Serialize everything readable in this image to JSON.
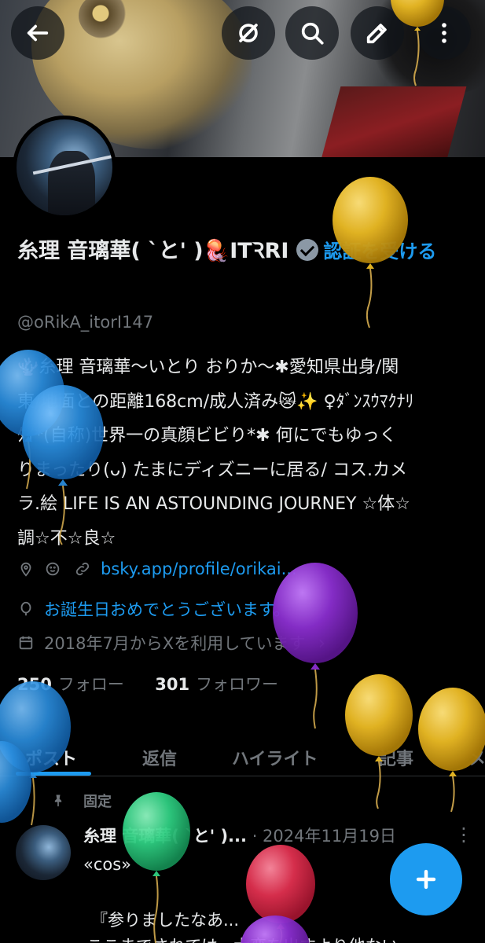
{
  "header": {
    "back_icon": "arrow-left-icon",
    "buttons": [
      "hide-media-icon",
      "search-icon",
      "edit-icon",
      "more-vertical-icon"
    ]
  },
  "profile": {
    "display_name": "糸理 音璃華( `と' )🪼ITꝚRI",
    "verify_link": "認証を受ける",
    "handle": "@oRikA_itorI147",
    "bio_lines": [
      "🪸糸理 音璃華〜いとり おりか〜✱愛知県出身/関",
      "東/地面との距離168cm/成人済み😿✨ ♀ﾀﾞﾝｽｳﾏｸﾅﾘ",
      "ﾀｲ*(自称)世界一の真顔ビビり*✱ 何にでもゆっく",
      "りまったり(ᴗ) たまにディズニーに居る/ コス.カメ",
      "ラ.絵 LIFE IS AN ASTOUNDING JOURNEY ☆体☆",
      "調☆不☆良☆"
    ],
    "location_icon": "location-pin-icon",
    "smile_icon": "smile-icon",
    "link_icon": "link-icon",
    "link_text": "bsky.app/profile/orikai...",
    "birthday_icon": "balloon-icon",
    "birthday_text": "お誕生日おめでとうございます。",
    "joined_icon": "calendar-icon",
    "joined_text": "2018年7月からXを利用しています",
    "following_count": "250",
    "following_label": "フォロー",
    "followers_count": "301",
    "followers_label": "フォロワー"
  },
  "tabs": [
    {
      "label": "ポスト"
    },
    {
      "label": "返信"
    },
    {
      "label": "ハイライト"
    },
    {
      "label": "記事"
    },
    {
      "label": "メ"
    }
  ],
  "post": {
    "pinned_label": "固定",
    "author": "糸理 音璃華( `と' )...",
    "date": "· 2024年11月19日",
    "line1": "«cos»",
    "line2": "『参りましたなあ...",
    "line3": "ここまでされては...大変を出すより他ない"
  },
  "fab_icon": "plus-icon",
  "balloon_colors": {
    "yellow": "#e8b824",
    "blue": "#2b8fe0",
    "purple": "#8b2fd0",
    "green": "#2fcf82",
    "red": "#e0304f"
  }
}
